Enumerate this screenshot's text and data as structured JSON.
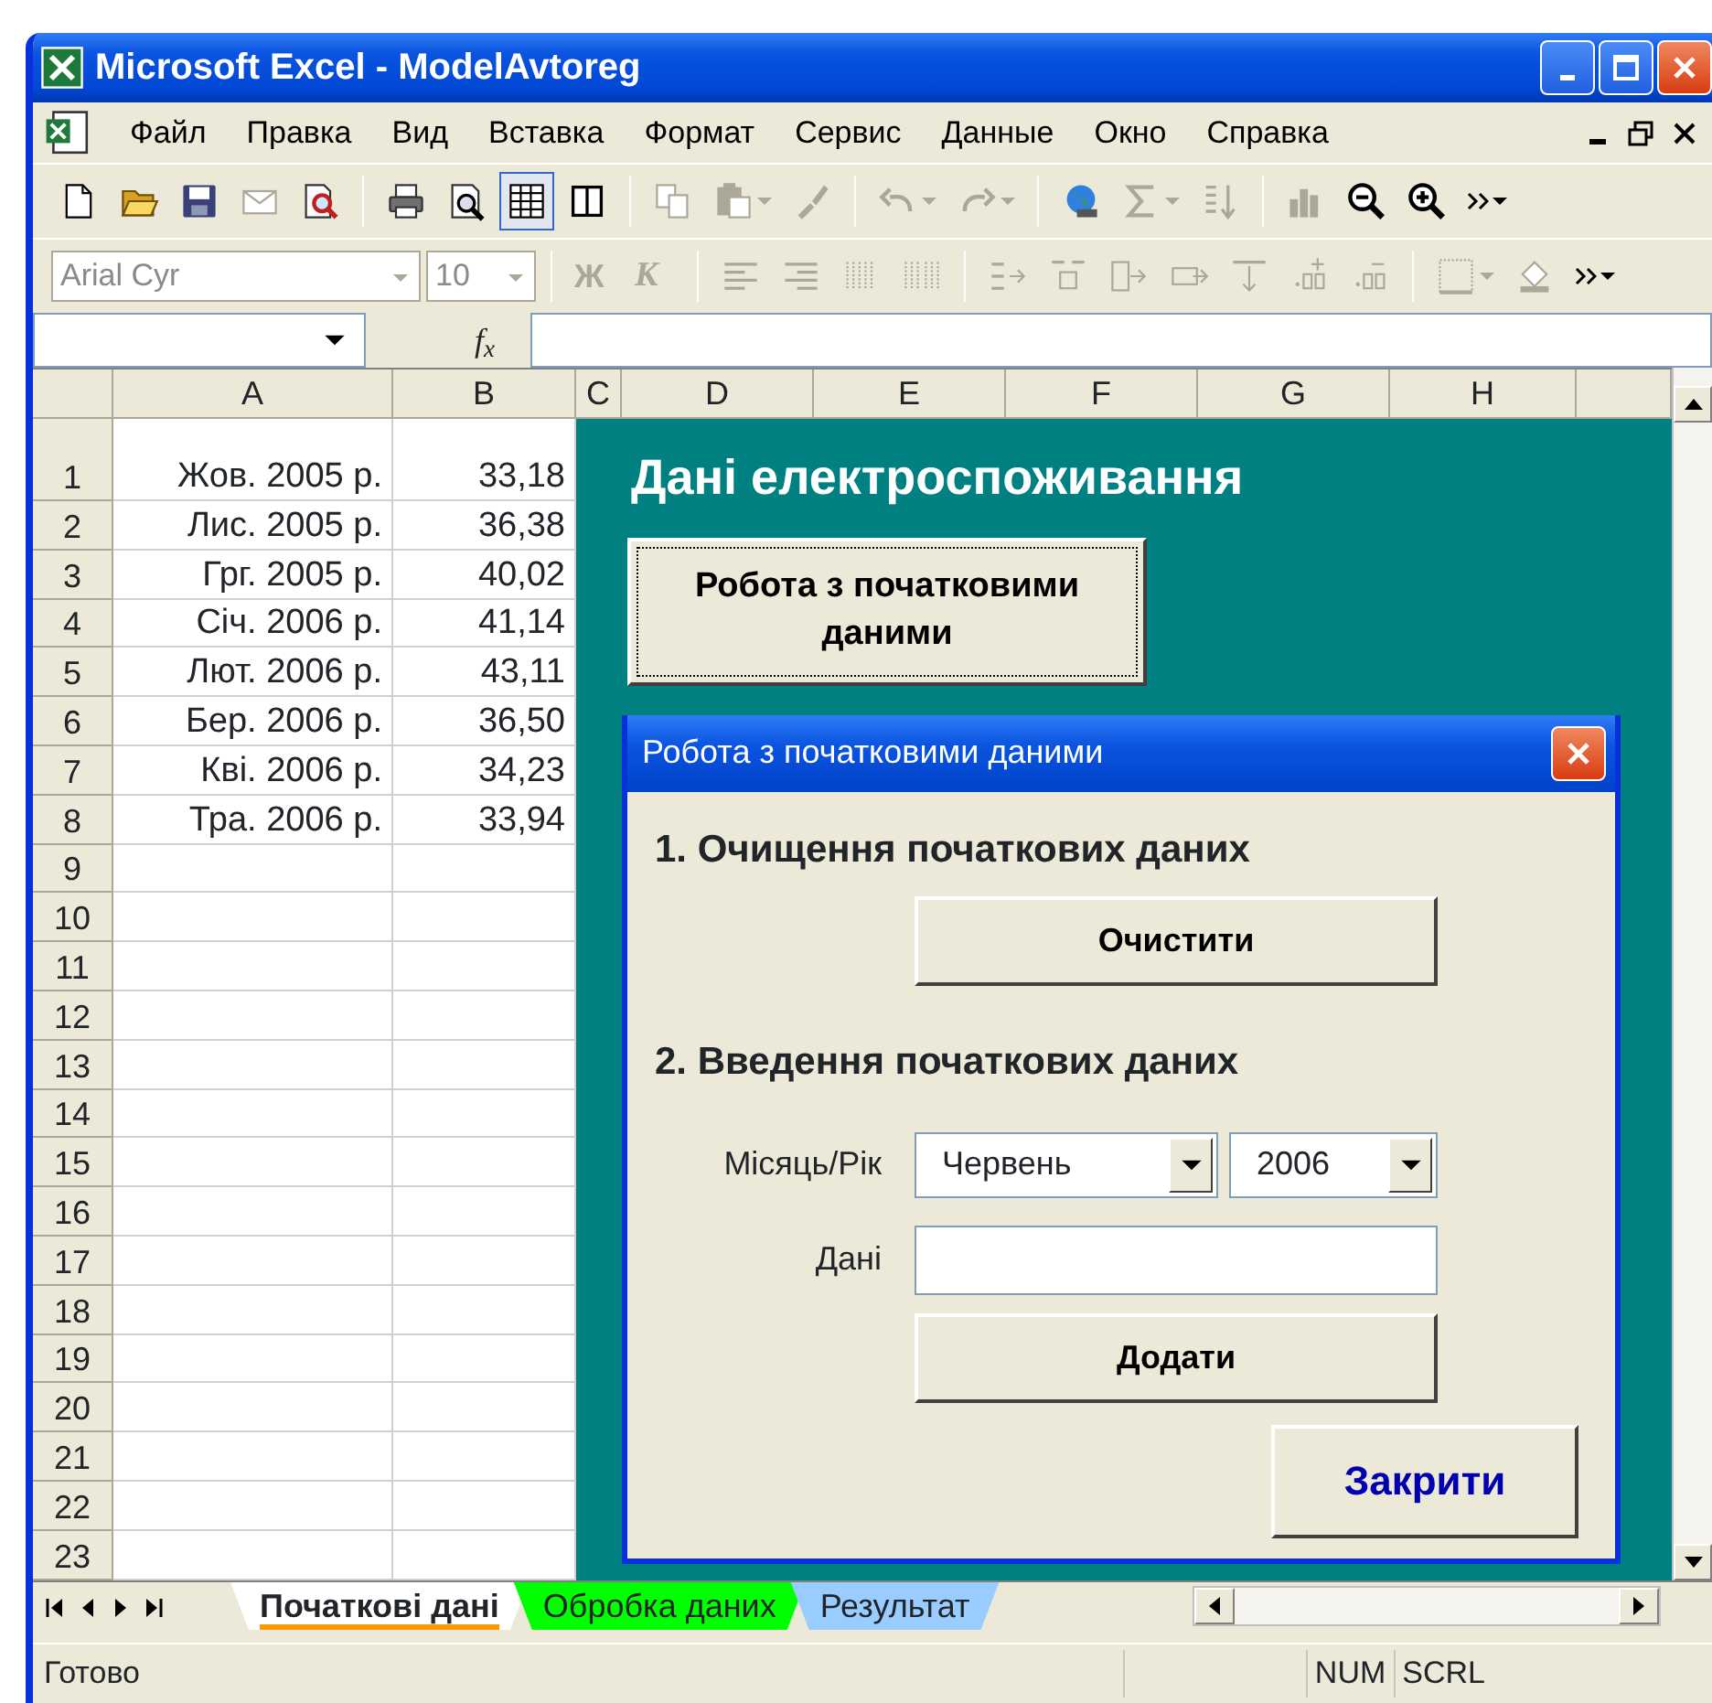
{
  "window": {
    "title": "Microsoft Excel - ModelAvtoreg"
  },
  "menu": [
    "Файл",
    "Правка",
    "Вид",
    "Вставка",
    "Формат",
    "Сервис",
    "Данные",
    "Окно",
    "Справка"
  ],
  "standard_toolbar": [
    {
      "kind": "button",
      "disabled": false,
      "pressed": false,
      "dropdown": false
    },
    {
      "kind": "button",
      "disabled": false,
      "pressed": false,
      "dropdown": false
    },
    {
      "kind": "button",
      "disabled": false,
      "pressed": false,
      "dropdown": false
    },
    {
      "kind": "button",
      "disabled": true,
      "pressed": false,
      "dropdown": false
    },
    {
      "kind": "button",
      "disabled": false,
      "pressed": false,
      "dropdown": false
    },
    {
      "kind": "separator"
    },
    {
      "kind": "button",
      "disabled": false,
      "pressed": false,
      "dropdown": false
    },
    {
      "kind": "button",
      "disabled": false,
      "pressed": false,
      "dropdown": false
    },
    {
      "kind": "button",
      "disabled": false,
      "pressed": true,
      "dropdown": false
    },
    {
      "kind": "button",
      "disabled": false,
      "pressed": false,
      "dropdown": false
    },
    {
      "kind": "separator"
    },
    {
      "kind": "button",
      "disabled": true,
      "pressed": false,
      "dropdown": false
    },
    {
      "kind": "button",
      "disabled": true,
      "pressed": false,
      "dropdown": true
    },
    {
      "kind": "button",
      "disabled": true,
      "pressed": false,
      "dropdown": false
    },
    {
      "kind": "separator"
    },
    {
      "kind": "button",
      "disabled": true,
      "pressed": false,
      "dropdown": true
    },
    {
      "kind": "button",
      "disabled": true,
      "pressed": false,
      "dropdown": true
    },
    {
      "kind": "separator"
    },
    {
      "kind": "button",
      "disabled": false,
      "pressed": false,
      "dropdown": false
    },
    {
      "kind": "button",
      "disabled": true,
      "pressed": false,
      "dropdown": true
    },
    {
      "kind": "button",
      "disabled": true,
      "pressed": false,
      "dropdown": false
    },
    {
      "kind": "separator"
    },
    {
      "kind": "button",
      "disabled": true,
      "pressed": false,
      "dropdown": false
    },
    {
      "kind": "button",
      "disabled": false,
      "pressed": false,
      "dropdown": false
    },
    {
      "kind": "button",
      "disabled": false,
      "pressed": false,
      "dropdown": false
    },
    {
      "kind": "button",
      "disabled": false,
      "pressed": false,
      "dropdown": true
    }
  ],
  "formatting_toolbar": {
    "disabled": true,
    "font": "Arial Cyr",
    "size": "10",
    "bold": "Ж",
    "italic": "К"
  },
  "formula_bar": {
    "fx": "f$_{x}$"
  },
  "sheet": {
    "columns": [
      "A",
      "B",
      "C",
      "D",
      "E",
      "F",
      "G",
      "H"
    ],
    "rows": [
      {
        "number": "1",
        "cells": [
          "Жов. 2005 р.",
          "33,18"
        ]
      },
      {
        "number": "2",
        "cells": [
          "Лис. 2005 р.",
          "36,38"
        ]
      },
      {
        "number": "3",
        "cells": [
          "Грг. 2005 р.",
          "40,02"
        ]
      },
      {
        "number": "4",
        "cells": [
          "Січ. 2006 р.",
          "41,14"
        ]
      },
      {
        "number": "5",
        "cells": [
          "Лют. 2006 р.",
          "43,11"
        ]
      },
      {
        "number": "6",
        "cells": [
          "Бер. 2006 р.",
          "36,50"
        ]
      },
      {
        "number": "7",
        "cells": [
          "Кві. 2006 р.",
          "34,23"
        ]
      },
      {
        "number": "8",
        "cells": [
          "Тра. 2006 р.",
          "33,94"
        ]
      },
      {
        "number": "9"
      },
      {
        "number": "10"
      },
      {
        "number": "11"
      },
      {
        "number": "12"
      },
      {
        "number": "13"
      },
      {
        "number": "14"
      },
      {
        "number": "15"
      },
      {
        "number": "16"
      },
      {
        "number": "17"
      },
      {
        "number": "18"
      },
      {
        "number": "19"
      },
      {
        "number": "20"
      },
      {
        "number": "21"
      },
      {
        "number": "22"
      },
      {
        "number": "23"
      }
    ]
  },
  "panel": {
    "title": "Дані електроспоживання",
    "button": "Робота з початковими даними"
  },
  "dialog": {
    "title": "Робота з початковими даними",
    "section_1": "1. Очищення початкових даних",
    "clear_button": "Очистити",
    "section_2": "2. Введення початкових даних",
    "month_label": "Місяць/Рік",
    "month": "Червень",
    "year": "2006",
    "data_label": "Дані",
    "add_button": "Додати",
    "close_button": "Закрити"
  },
  "sheet_tabs": [
    {
      "label": "Початкові дані",
      "selected": true,
      "color": "#ff9900"
    },
    {
      "label": "Обробка даних",
      "selected": false,
      "color": "#00ff00"
    },
    {
      "label": "Результат",
      "selected": false,
      "color": "#99ccff"
    }
  ],
  "status_bar": {
    "status": "Готово",
    "indicators": [
      "NUM",
      "SCRL"
    ]
  }
}
